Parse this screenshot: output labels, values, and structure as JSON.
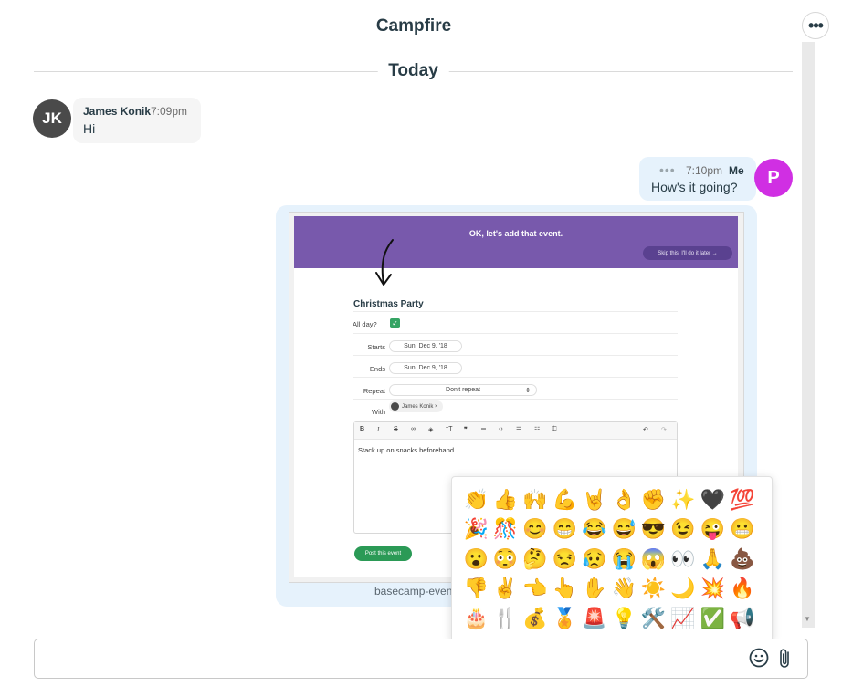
{
  "header": {
    "title": "Campfire",
    "more_icon": "ellipsis-icon"
  },
  "day_divider": {
    "label": "Today"
  },
  "messages": [
    {
      "author": "James Konik",
      "initials": "JK",
      "time": "7:09pm",
      "text": "Hi",
      "avatar_color": "#4a4a4a"
    },
    {
      "author": "Me",
      "initials": "P",
      "time": "7:10pm",
      "text": "How's it going?",
      "status": "•••",
      "avatar_color": "#d02fe3"
    }
  ],
  "attachment": {
    "caption": "basecamp-even",
    "preview": {
      "banner_title": "OK, let's add that event.",
      "skip_label": "Skip this, I'll do it later →",
      "event_title": "Christmas Party",
      "all_day_label": "All day?",
      "all_day_checked": true,
      "starts_label": "Starts",
      "starts_value": "Sun, Dec 9, '18",
      "ends_label": "Ends",
      "ends_value": "Sun, Dec 9, '18",
      "repeat_label": "Repeat",
      "repeat_value": "Don't repeat",
      "with_label": "With",
      "with_value": "James Konik ×",
      "notes": "Stack up on snacks beforehand",
      "post_label": "Post this event"
    }
  },
  "emoji_picker": {
    "emojis": [
      "👏",
      "👍",
      "🙌",
      "💪",
      "🤘",
      "👌",
      "✊",
      "✨",
      "🖤",
      "💯",
      "🎉",
      "🎊",
      "😊",
      "😁",
      "😂",
      "😅",
      "😎",
      "😉",
      "😜",
      "😬",
      "😮",
      "😳",
      "🤔",
      "😒",
      "😥",
      "😭",
      "😱",
      "👀",
      "🙏",
      "💩",
      "👎",
      "✌️",
      "👈",
      "👆",
      "✋",
      "👋",
      "☀️",
      "🌙",
      "💥",
      "🔥",
      "🎂",
      "🍴",
      "💰",
      "🏅",
      "🚨",
      "💡",
      "🛠️",
      "📈",
      "✅",
      "📢"
    ]
  },
  "composer": {
    "placeholder": "",
    "value": "",
    "emoji_icon": "smiley-icon",
    "attach_icon": "paperclip-icon"
  }
}
